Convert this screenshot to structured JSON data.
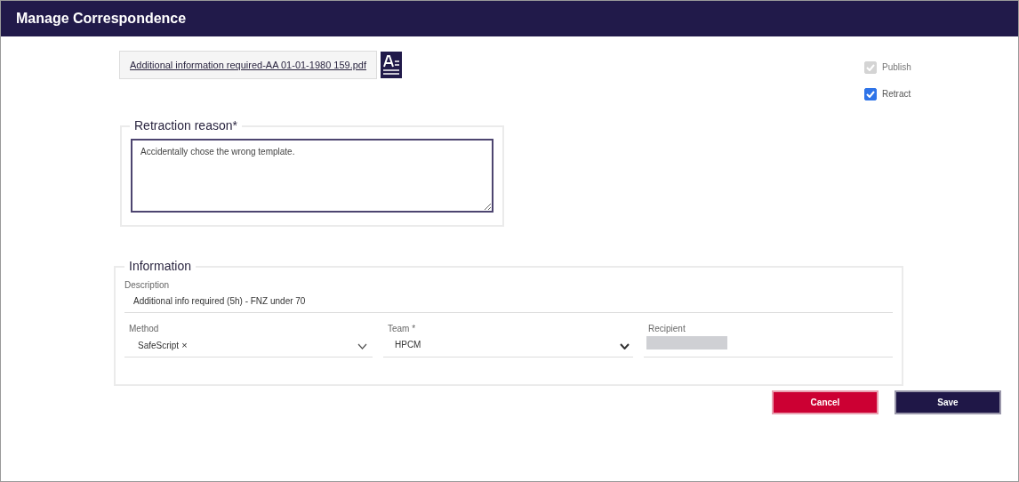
{
  "window": {
    "title": "Manage Correspondence"
  },
  "attachment": {
    "filename": "Additional information required-AA 01-01-1980 159.pdf"
  },
  "options": [
    {
      "label": "Publish",
      "checked": true,
      "disabled": true
    },
    {
      "label": "Retract",
      "checked": true,
      "disabled": false
    }
  ],
  "retraction": {
    "legend": "Retraction reason*",
    "value": "Accidentally chose the wrong template."
  },
  "information": {
    "legend": "Information",
    "description_label": "Description",
    "description": "Additional info required (5h) - FNZ under 70",
    "method": {
      "label": "Method",
      "value": "SafeScript",
      "clear": "×"
    },
    "team": {
      "label": "Team *",
      "value": "HPCM"
    },
    "recipient": {
      "label": "Recipient"
    }
  },
  "buttons": [
    {
      "label": "Cancel",
      "kind": "danger"
    },
    {
      "label": "Save",
      "kind": "primary"
    }
  ]
}
